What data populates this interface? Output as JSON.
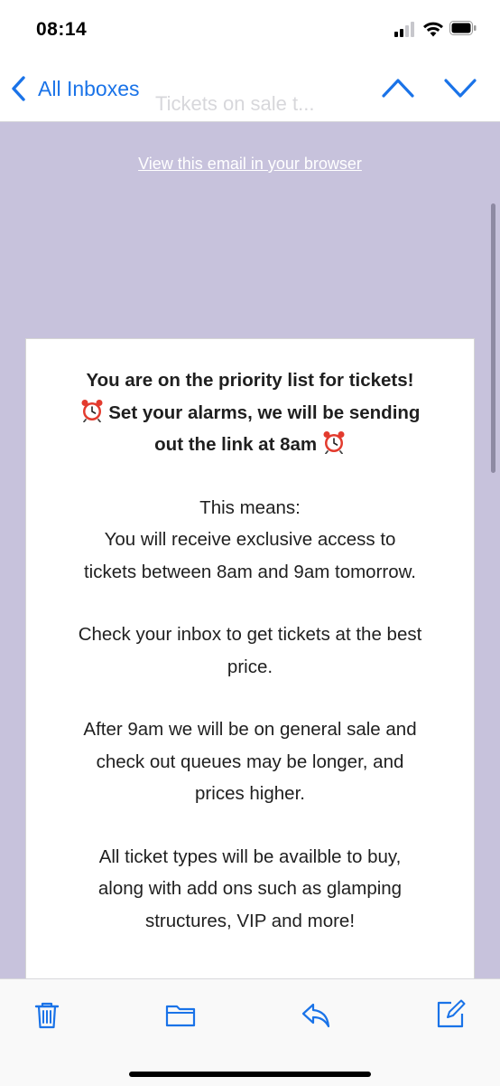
{
  "status_bar": {
    "time": "08:14",
    "icons": [
      "signal-icon",
      "wifi-icon",
      "battery-icon"
    ]
  },
  "nav": {
    "back_label": "All Inboxes",
    "title": "Tickets on sale t...",
    "icons": [
      "chevron-left-icon",
      "chevron-up-icon",
      "chevron-down-icon"
    ]
  },
  "email": {
    "view_in_browser": "View this email in your browser",
    "headline_1": "You are on the priority list for tickets!",
    "headline_2": "Set your alarms, we will be sending",
    "headline_3": "out the link at 8am",
    "para_1_line_1": "This means:",
    "para_1_line_2": "You will receive exclusive access to",
    "para_1_line_3": "tickets between 8am and 9am tomorrow.",
    "para_2_line_1": "Check your inbox to get tickets at the best",
    "para_2_line_2": "price.",
    "para_3_line_1": "After 9am we will be on general sale and",
    "para_3_line_2": "check out queues may be longer, and",
    "para_3_line_3": "prices higher.",
    "para_4_line_1": "All ticket types will be availble to buy,",
    "para_4_line_2": "along with add ons such as glamping",
    "para_4_line_3": "structures, VIP and more!",
    "emoji_icon": "alarm-clock-icon"
  },
  "toolbar": {
    "icons": [
      "trash-icon",
      "folder-icon",
      "reply-icon",
      "compose-icon"
    ]
  },
  "colors": {
    "accent": "#1a73e8",
    "email_background": "#c7c2dc",
    "card_background": "#ffffff",
    "text": "#1f1f1f"
  }
}
